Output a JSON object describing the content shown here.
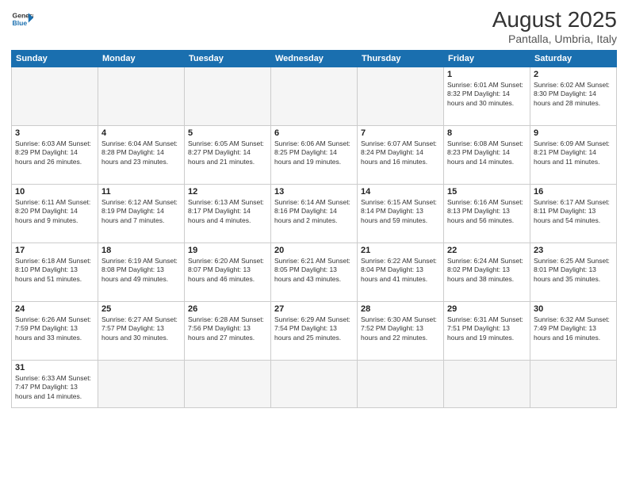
{
  "logo": {
    "text_general": "General",
    "text_blue": "Blue"
  },
  "title": "August 2025",
  "subtitle": "Pantalla, Umbria, Italy",
  "days_of_week": [
    "Sunday",
    "Monday",
    "Tuesday",
    "Wednesday",
    "Thursday",
    "Friday",
    "Saturday"
  ],
  "weeks": [
    [
      {
        "day": "",
        "info": ""
      },
      {
        "day": "",
        "info": ""
      },
      {
        "day": "",
        "info": ""
      },
      {
        "day": "",
        "info": ""
      },
      {
        "day": "",
        "info": ""
      },
      {
        "day": "1",
        "info": "Sunrise: 6:01 AM\nSunset: 8:32 PM\nDaylight: 14 hours and 30 minutes."
      },
      {
        "day": "2",
        "info": "Sunrise: 6:02 AM\nSunset: 8:30 PM\nDaylight: 14 hours and 28 minutes."
      }
    ],
    [
      {
        "day": "3",
        "info": "Sunrise: 6:03 AM\nSunset: 8:29 PM\nDaylight: 14 hours and 26 minutes."
      },
      {
        "day": "4",
        "info": "Sunrise: 6:04 AM\nSunset: 8:28 PM\nDaylight: 14 hours and 23 minutes."
      },
      {
        "day": "5",
        "info": "Sunrise: 6:05 AM\nSunset: 8:27 PM\nDaylight: 14 hours and 21 minutes."
      },
      {
        "day": "6",
        "info": "Sunrise: 6:06 AM\nSunset: 8:25 PM\nDaylight: 14 hours and 19 minutes."
      },
      {
        "day": "7",
        "info": "Sunrise: 6:07 AM\nSunset: 8:24 PM\nDaylight: 14 hours and 16 minutes."
      },
      {
        "day": "8",
        "info": "Sunrise: 6:08 AM\nSunset: 8:23 PM\nDaylight: 14 hours and 14 minutes."
      },
      {
        "day": "9",
        "info": "Sunrise: 6:09 AM\nSunset: 8:21 PM\nDaylight: 14 hours and 11 minutes."
      }
    ],
    [
      {
        "day": "10",
        "info": "Sunrise: 6:11 AM\nSunset: 8:20 PM\nDaylight: 14 hours and 9 minutes."
      },
      {
        "day": "11",
        "info": "Sunrise: 6:12 AM\nSunset: 8:19 PM\nDaylight: 14 hours and 7 minutes."
      },
      {
        "day": "12",
        "info": "Sunrise: 6:13 AM\nSunset: 8:17 PM\nDaylight: 14 hours and 4 minutes."
      },
      {
        "day": "13",
        "info": "Sunrise: 6:14 AM\nSunset: 8:16 PM\nDaylight: 14 hours and 2 minutes."
      },
      {
        "day": "14",
        "info": "Sunrise: 6:15 AM\nSunset: 8:14 PM\nDaylight: 13 hours and 59 minutes."
      },
      {
        "day": "15",
        "info": "Sunrise: 6:16 AM\nSunset: 8:13 PM\nDaylight: 13 hours and 56 minutes."
      },
      {
        "day": "16",
        "info": "Sunrise: 6:17 AM\nSunset: 8:11 PM\nDaylight: 13 hours and 54 minutes."
      }
    ],
    [
      {
        "day": "17",
        "info": "Sunrise: 6:18 AM\nSunset: 8:10 PM\nDaylight: 13 hours and 51 minutes."
      },
      {
        "day": "18",
        "info": "Sunrise: 6:19 AM\nSunset: 8:08 PM\nDaylight: 13 hours and 49 minutes."
      },
      {
        "day": "19",
        "info": "Sunrise: 6:20 AM\nSunset: 8:07 PM\nDaylight: 13 hours and 46 minutes."
      },
      {
        "day": "20",
        "info": "Sunrise: 6:21 AM\nSunset: 8:05 PM\nDaylight: 13 hours and 43 minutes."
      },
      {
        "day": "21",
        "info": "Sunrise: 6:22 AM\nSunset: 8:04 PM\nDaylight: 13 hours and 41 minutes."
      },
      {
        "day": "22",
        "info": "Sunrise: 6:24 AM\nSunset: 8:02 PM\nDaylight: 13 hours and 38 minutes."
      },
      {
        "day": "23",
        "info": "Sunrise: 6:25 AM\nSunset: 8:01 PM\nDaylight: 13 hours and 35 minutes."
      }
    ],
    [
      {
        "day": "24",
        "info": "Sunrise: 6:26 AM\nSunset: 7:59 PM\nDaylight: 13 hours and 33 minutes."
      },
      {
        "day": "25",
        "info": "Sunrise: 6:27 AM\nSunset: 7:57 PM\nDaylight: 13 hours and 30 minutes."
      },
      {
        "day": "26",
        "info": "Sunrise: 6:28 AM\nSunset: 7:56 PM\nDaylight: 13 hours and 27 minutes."
      },
      {
        "day": "27",
        "info": "Sunrise: 6:29 AM\nSunset: 7:54 PM\nDaylight: 13 hours and 25 minutes."
      },
      {
        "day": "28",
        "info": "Sunrise: 6:30 AM\nSunset: 7:52 PM\nDaylight: 13 hours and 22 minutes."
      },
      {
        "day": "29",
        "info": "Sunrise: 6:31 AM\nSunset: 7:51 PM\nDaylight: 13 hours and 19 minutes."
      },
      {
        "day": "30",
        "info": "Sunrise: 6:32 AM\nSunset: 7:49 PM\nDaylight: 13 hours and 16 minutes."
      }
    ],
    [
      {
        "day": "31",
        "info": "Sunrise: 6:33 AM\nSunset: 7:47 PM\nDaylight: 13 hours and 14 minutes."
      },
      {
        "day": "",
        "info": ""
      },
      {
        "day": "",
        "info": ""
      },
      {
        "day": "",
        "info": ""
      },
      {
        "day": "",
        "info": ""
      },
      {
        "day": "",
        "info": ""
      },
      {
        "day": "",
        "info": ""
      }
    ]
  ]
}
